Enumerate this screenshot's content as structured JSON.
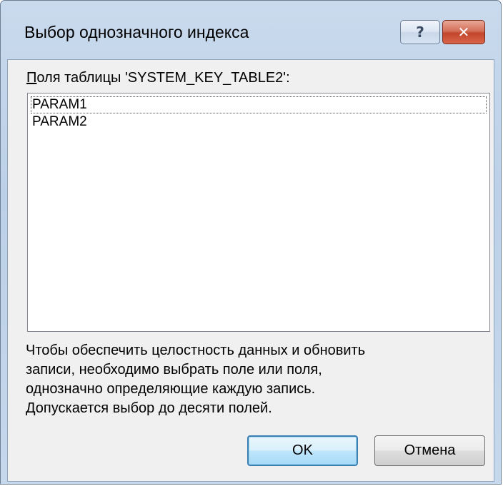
{
  "window": {
    "title": "Выбор однозначного индекса",
    "help_label": "?",
    "close_label": "✕"
  },
  "fields": {
    "label_accel": "П",
    "label_rest": "оля таблицы 'SYSTEM_KEY_TABLE2':",
    "items": [
      "PARAM1",
      "PARAM2"
    ]
  },
  "info": {
    "lines": [
      "Чтобы обеспечить целостность данных и обновить",
      "записи, необходимо выбрать поле или поля,",
      "однозначно определяющие каждую запись.",
      "Допускается выбор до десяти полей."
    ]
  },
  "buttons": {
    "ok_label": "OK",
    "cancel_label": "Отмена"
  },
  "colors": {
    "title_bar": "#c4d6eb",
    "client_bg": "#f0f0f0",
    "close_button": "#c94a30",
    "default_button_border": "#3c7fb1"
  }
}
